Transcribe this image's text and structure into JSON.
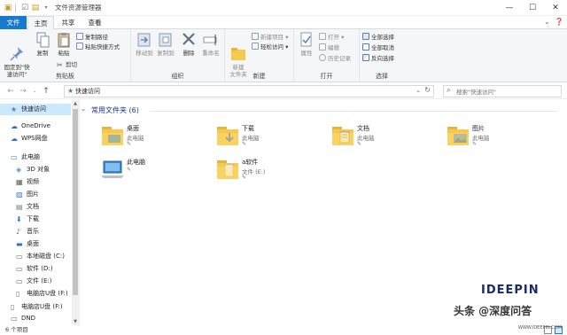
{
  "window": {
    "title": "文件资源管理器",
    "controls": {
      "minimize": "—",
      "maximize": "☐",
      "close": "✕"
    }
  },
  "tabs": [
    {
      "label": "文件"
    },
    {
      "label": "主页"
    },
    {
      "label": "共享"
    },
    {
      "label": "查看"
    }
  ],
  "ribbon": {
    "clipboard": {
      "label": "剪贴板",
      "pin": "固定到\"快\n速访问\"",
      "copy": "复制",
      "paste": "粘贴",
      "copy_path": "复制路径",
      "paste_shortcut": "粘贴快捷方式",
      "cut": "剪切"
    },
    "organize": {
      "label": "组织",
      "move_to": "移动到",
      "copy_to": "复制到",
      "delete": "删除",
      "rename": "重命名"
    },
    "new": {
      "label": "新建",
      "new_folder": "新建\n文件夹",
      "new_item": "新建项目",
      "easy_access": "轻松访问"
    },
    "open": {
      "label": "打开",
      "properties": "属性",
      "open": "打开",
      "edit": "编辑",
      "history": "历史记录"
    },
    "select": {
      "label": "选择",
      "select_all": "全部选择",
      "select_none": "全部取消",
      "invert": "反向选择"
    }
  },
  "address": {
    "path": "快速访问",
    "search_placeholder": "搜索\"快速访问\""
  },
  "nav": {
    "items": [
      {
        "label": "快速访问",
        "icon": "star-icon",
        "selected": true
      },
      {
        "label": "OneDrive",
        "icon": "cloud-icon"
      },
      {
        "label": "WPS网盘",
        "icon": "cloud-icon"
      },
      {
        "label": "此电脑",
        "icon": "computer-icon"
      },
      {
        "label": "3D 对象",
        "icon": "cube-icon"
      },
      {
        "label": "视频",
        "icon": "video-icon"
      },
      {
        "label": "图片",
        "icon": "picture-icon"
      },
      {
        "label": "文档",
        "icon": "document-icon"
      },
      {
        "label": "下载",
        "icon": "download-icon"
      },
      {
        "label": "音乐",
        "icon": "music-icon"
      },
      {
        "label": "桌面",
        "icon": "desktop-icon"
      },
      {
        "label": "本地磁盘 (C:)",
        "icon": "drive-icon"
      },
      {
        "label": "软件 (D:)",
        "icon": "drive-icon"
      },
      {
        "label": "文件 (E:)",
        "icon": "drive-icon"
      },
      {
        "label": "电脑店U盘 (F:)",
        "icon": "usb-icon"
      },
      {
        "label": "电脑店U盘 (F:)",
        "icon": "usb-icon"
      },
      {
        "label": "DND",
        "icon": "drive-icon"
      }
    ]
  },
  "content": {
    "section_title": "常用文件夹 (6)",
    "tiles": [
      {
        "name": "桌面",
        "sub": "此电脑",
        "pin": "✎",
        "icon": "desktop-folder-icon"
      },
      {
        "name": "下载",
        "sub": "此电脑",
        "pin": "✎",
        "icon": "download-folder-icon"
      },
      {
        "name": "文档",
        "sub": "此电脑",
        "pin": "✎",
        "icon": "document-folder-icon"
      },
      {
        "name": "图片",
        "sub": "此电脑",
        "pin": "✎",
        "icon": "picture-folder-icon"
      },
      {
        "name": "此电脑",
        "sub": "",
        "pin": "✎",
        "icon": "computer-icon"
      },
      {
        "name": "a软件",
        "sub": "文件 (E:)",
        "pin": "✎",
        "icon": "folder-icon"
      }
    ]
  },
  "status": {
    "count": "6 个项目"
  },
  "watermark": {
    "logo": "IDEEPIN",
    "text": "头条 @深度问答",
    "url": "WWW.IDEEPIN.COM"
  },
  "colors": {
    "accent": "#1979ca",
    "folder": "#f6c94e",
    "selection": "#cce8ff",
    "section_title": "#1e3287"
  }
}
